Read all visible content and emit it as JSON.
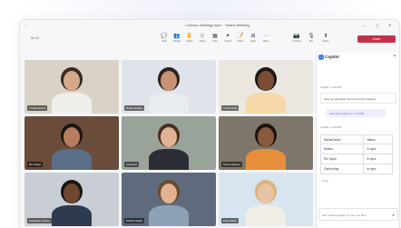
{
  "window": {
    "title": "Contoso Strategy sync · Teams Meeting",
    "back": "←",
    "min": "—",
    "max": "▢",
    "close": "✕"
  },
  "toolbar": {
    "time": "01:12",
    "buttons": [
      {
        "icon": "chat-icon",
        "glyph": "💬",
        "label": "Chat"
      },
      {
        "icon": "people-icon",
        "glyph": "👥",
        "label": "People"
      },
      {
        "icon": "raise-hand-icon",
        "glyph": "✋",
        "label": "Raise"
      },
      {
        "icon": "react-icon",
        "glyph": "☺",
        "label": "React"
      },
      {
        "icon": "view-icon",
        "glyph": "▦",
        "label": "View"
      },
      {
        "icon": "copilot-icon",
        "glyph": "✦",
        "label": "Copilot"
      },
      {
        "icon": "notes-icon",
        "glyph": "📝",
        "label": "Notes"
      },
      {
        "icon": "apps-icon",
        "glyph": "⊞",
        "label": "Apps"
      },
      {
        "icon": "more-icon",
        "glyph": "⋯",
        "label": "More"
      },
      {
        "icon": "camera-icon",
        "glyph": "📷",
        "label": "Camera"
      },
      {
        "icon": "mic-icon",
        "glyph": "🎙",
        "label": "Mic"
      },
      {
        "icon": "share-icon",
        "glyph": "⬆",
        "label": "Share"
      }
    ],
    "leave_label": "Leave"
  },
  "participants": [
    {
      "name": "Amelia Evans",
      "bg": "#d9d2c6",
      "skin": "#d8a989",
      "hair": "#3a2a22",
      "shirt": "#f1efe9"
    },
    {
      "name": "Noah Hansen",
      "bg": "#dfe4ea",
      "skin": "#c99272",
      "hair": "#2a2320",
      "shirt": "#e8ebef"
    },
    {
      "name": "Carla Irving",
      "bg": "#ebe6df",
      "skin": "#7a4d34",
      "hair": "#1f1814",
      "shirt": "#f7d9a9"
    },
    {
      "name": "Rio Taylor",
      "bg": "#6a4c3a",
      "skin": "#b77d5e",
      "hair": "#1d1613",
      "shirt": "#5a6e88"
    },
    {
      "name": "Lisa Ruiz",
      "bg": "#9aa39a",
      "skin": "#e0b394",
      "hair": "#4a3022",
      "shirt": "#2b2e34"
    },
    {
      "name": "Kiera Jackson",
      "bg": "#7e766a",
      "skin": "#8a5a3e",
      "hair": "#1b1410",
      "shirt": "#e58f3c"
    },
    {
      "name": "Sebastian Frame",
      "bg": "#c9ced6",
      "skin": "#6e472f",
      "hair": "#1a1512",
      "shirt": "#2d3a4f"
    },
    {
      "name": "Nathan Rigby",
      "bg": "#5e6b7c",
      "skin": "#e2b392",
      "hair": "#6a4a2e",
      "shirt": "#8fa1b8"
    },
    {
      "name": "Priya Shah",
      "bg": "#d6e5ef",
      "skin": "#e9c3a6",
      "hair": "#d7b47c",
      "shirt": "#f0ece6"
    }
  ],
  "copilot": {
    "title": "Copilot",
    "close": "✕",
    "section1": "Copilot · 1:12 PM",
    "prompt": "Give me the action items from this meeting",
    "note": "Summary based on 1:10 PM",
    "section2": "Copilot · 1:13 PM",
    "table": [
      [
        "Name/Owner",
        "Status"
      ],
      [
        "Amelia",
        "In sync"
      ],
      [
        "Rio Taylor",
        "In sync"
      ],
      [
        "Carla Irving",
        "In sync"
      ]
    ],
    "copy": "Copy",
    "input_hint": "Ask a work question or use / for files",
    "send_icon": "➤"
  }
}
